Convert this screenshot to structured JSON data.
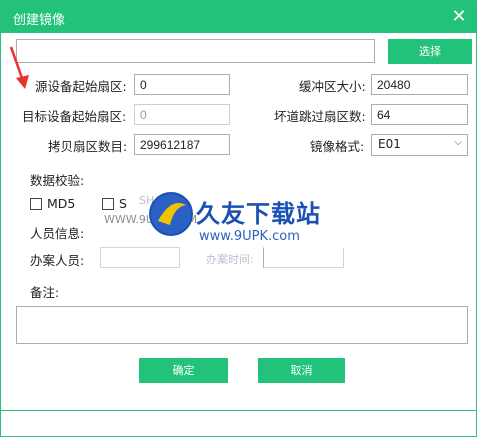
{
  "window": {
    "title": "创建镜像",
    "close_glyph": "✕"
  },
  "path": {
    "value": "",
    "select_label": "选择"
  },
  "fields": {
    "source_start_sector": {
      "label": "源设备起始扇区:",
      "value": "0"
    },
    "target_start_sector": {
      "label": "目标设备起始扇区:",
      "value": "0"
    },
    "copy_sector_count": {
      "label": "拷贝扇区数目:",
      "value": "299612187"
    },
    "buffer_size": {
      "label": "缓冲区大小:",
      "value": "20480"
    },
    "bad_sector_skip": {
      "label": "坏道跳过扇区数:",
      "value": "64"
    },
    "image_format": {
      "label": "镜像格式:",
      "value": "E01"
    }
  },
  "verify": {
    "label": "数据校验:",
    "md5_label": "MD5",
    "sha_label": "S"
  },
  "personnel": {
    "info_label": "人员信息:",
    "handler_label": "办案人员:",
    "handler_value": "",
    "second_value": "",
    "third_value": ""
  },
  "remarks": {
    "label": "备注:",
    "value": ""
  },
  "buttons": {
    "ok": "确定",
    "cancel": "取消"
  },
  "watermark": {
    "main": "久友下载站",
    "sub": "www.9UPK.com",
    "faint_url": "WWW.9UPK.COM",
    "faint_sha": "SHA",
    "faint_time": "办案时间:"
  },
  "colors": {
    "accent": "#23c27a",
    "arrow": "#e8332a",
    "watermark_blue": "#1a4fb3"
  }
}
